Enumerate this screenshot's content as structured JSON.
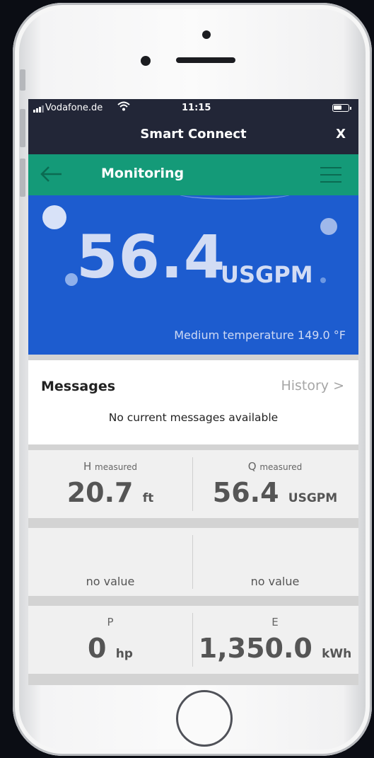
{
  "status_bar": {
    "carrier": "Vodafone.de",
    "time": "11:15"
  },
  "title_bar": {
    "title": "Smart Connect",
    "close_label": "X"
  },
  "nav_bar": {
    "title": "Monitoring",
    "back_icon": "arrow-left-icon",
    "menu_icon": "hamburger-menu-icon"
  },
  "hero": {
    "value": "56.4",
    "unit": "USGPM",
    "medium_temperature": "Medium temperature 149.0 °F"
  },
  "messages": {
    "title": "Messages",
    "history_label": "History >",
    "empty_text": "No current messages available"
  },
  "tiles": [
    {
      "label": "H",
      "label_sub": "measured",
      "value": "20.7",
      "unit": "ft"
    },
    {
      "label": "Q",
      "label_sub": "measured",
      "value": "56.4",
      "unit": "USGPM"
    },
    {
      "empty_text": "no value"
    },
    {
      "empty_text": "no value"
    },
    {
      "label": "P",
      "value": "0",
      "unit": "hp"
    },
    {
      "label": "E",
      "value": "1,350.0",
      "unit": "kWh"
    }
  ],
  "colors": {
    "header": "#222637",
    "nav_green": "#149a78",
    "hero_blue": "#1d5ccf",
    "tile_bg": "#f0f0f0"
  }
}
